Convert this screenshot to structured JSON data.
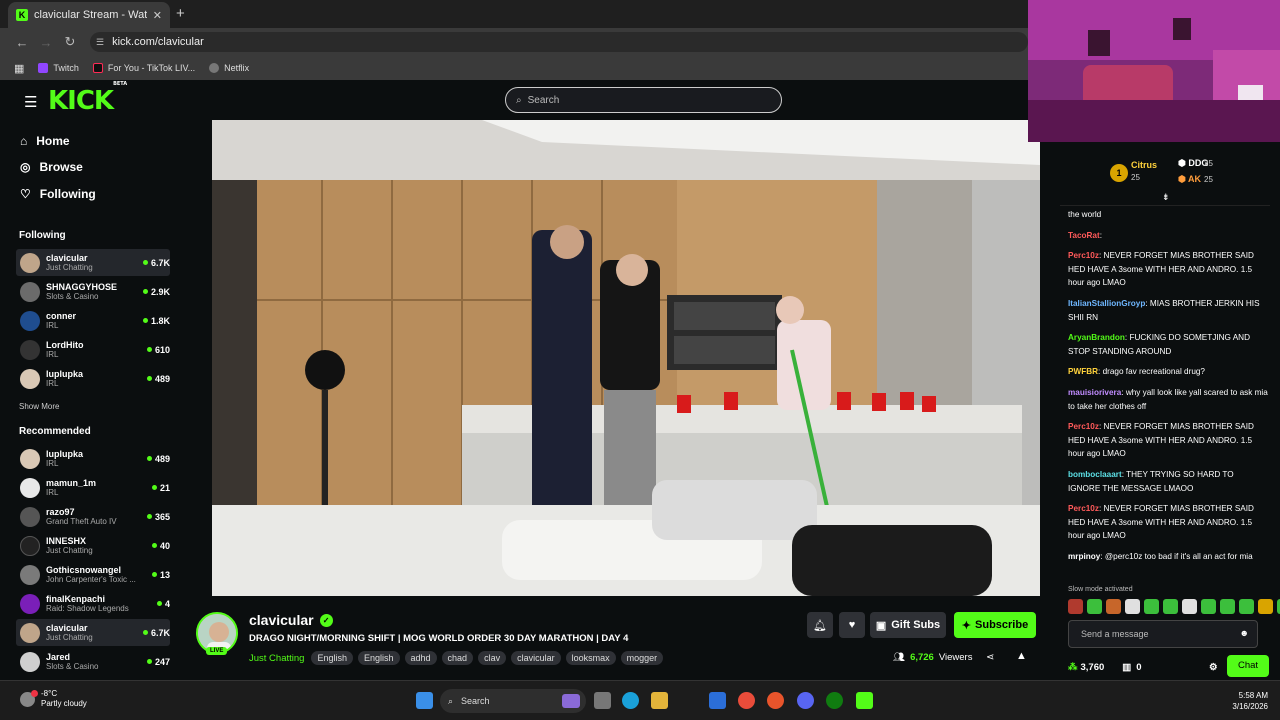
{
  "browser": {
    "tab_title": "clavicular Stream - Watch Live ...",
    "url": "kick.com/clavicular",
    "bookmarks": [
      "Twitch",
      "For You - TikTok LIV...",
      "Netflix"
    ]
  },
  "header": {
    "logo": "KICK",
    "logo_badge": "BETA",
    "search_placeholder": "Search"
  },
  "sidebar": {
    "nav": [
      {
        "label": "Home",
        "icon": "home-icon"
      },
      {
        "label": "Browse",
        "icon": "compass-icon"
      },
      {
        "label": "Following",
        "icon": "heart-icon"
      }
    ],
    "following_heading": "Following",
    "following": [
      {
        "name": "clavicular",
        "category": "Just Chatting",
        "viewers": "6.7K"
      },
      {
        "name": "SHNAGGYHOSE",
        "category": "Slots & Casino",
        "viewers": "2.9K"
      },
      {
        "name": "conner",
        "category": "IRL",
        "viewers": "1.8K"
      },
      {
        "name": "LordHito",
        "category": "IRL",
        "viewers": "610"
      },
      {
        "name": "luplupka",
        "category": "IRL",
        "viewers": "489"
      }
    ],
    "show_more": "Show More",
    "recommended_heading": "Recommended",
    "recommended": [
      {
        "name": "luplupka",
        "category": "IRL",
        "viewers": "489"
      },
      {
        "name": "mamun_1m",
        "category": "IRL",
        "viewers": "21"
      },
      {
        "name": "razo97",
        "category": "Grand Theft Auto IV",
        "viewers": "365"
      },
      {
        "name": "INNESHX",
        "category": "Just Chatting",
        "viewers": "40"
      },
      {
        "name": "Gothicsnowangel",
        "category": "John Carpenter's Toxic ...",
        "viewers": "13"
      },
      {
        "name": "finalKenpachi",
        "category": "Raid: Shadow Legends",
        "viewers": "4"
      },
      {
        "name": "clavicular",
        "category": "Just Chatting",
        "viewers": "6.7K"
      },
      {
        "name": "Jared",
        "category": "Slots & Casino",
        "viewers": "247"
      }
    ]
  },
  "stream": {
    "streamer": "clavicular",
    "live_badge": "LIVE",
    "title": "DRAGO NIGHT/MORNING SHIFT | MOG WORLD ORDER 30 DAY MARATHON | DAY 4",
    "category": "Just Chatting",
    "tags": [
      "English",
      "English",
      "adhd",
      "chad",
      "clav",
      "clavicular",
      "looksmax",
      "mogger"
    ],
    "gift_label": "Gift Subs",
    "subscribe_label": "Subscribe",
    "viewers": "6,726",
    "viewers_label": "Viewers"
  },
  "chat": {
    "leaderboard": [
      {
        "name": "Citrus",
        "value": "25"
      },
      {
        "name": "DDG",
        "value": "25"
      },
      {
        "name": "AK",
        "value": "25"
      }
    ],
    "messages": [
      {
        "user": "",
        "text": "the world",
        "color": "#ffffff"
      },
      {
        "user": "TacoRat",
        "text": "",
        "color": "#ff5a5a"
      },
      {
        "user": "Perc10z",
        "text": "NEVER FORGET MIAS BROTHER SAID HED HAVE A 3some WITH HER AND ANDRO. 1.5 hour ago LMAO",
        "color": "#ff5a5a"
      },
      {
        "user": "ItalianStallionGroyp",
        "text": "MIAS BROTHER JERKIN HIS SHII RN",
        "color": "#6fb7ff"
      },
      {
        "user": "AryanBrandon",
        "text": "FUCKING DO SOMETJING AND STOP STANDING AROUND",
        "color": "#53fc18"
      },
      {
        "user": "PWFBR",
        "text": "drago fav recreational drug?",
        "color": "#ffd23c"
      },
      {
        "user": "mauisiorivera",
        "text": "why yall look like yall scared to ask mia to take her clothes off",
        "color": "#c18cff"
      },
      {
        "user": "Perc10z",
        "text": "NEVER FORGET MIAS BROTHER SAID HED HAVE A 3some WITH HER AND ANDRO. 1.5 hour ago LMAO",
        "color": "#ff5a5a"
      },
      {
        "user": "bomboclaaart",
        "text": "THEY TRYING SO HARD TO IGNORE THE MESSAGE LMAOO",
        "color": "#5ce0e6"
      },
      {
        "user": "Perc10z",
        "text": "NEVER FORGET MIAS BROTHER SAID HED HAVE A 3some WITH HER AND ANDRO. 1.5 hour ago LMAO",
        "color": "#ff5a5a"
      },
      {
        "user": "mrpinoy",
        "text": "@perc10z too bad if it's all an act for mia",
        "color": "#ffffff"
      }
    ],
    "slow_mode": "Slow mode activated",
    "input_placeholder": "Send a message",
    "points": "3,760",
    "inventory": "0",
    "chat_button": "Chat"
  },
  "taskbar": {
    "temp": "-8°C",
    "weather": "Partly cloudy",
    "search": "Search",
    "time": "5:58 AM",
    "date": "3/16/2026"
  },
  "colors": {
    "accent": "#53fc18",
    "background": "#0b0e0f",
    "surface": "#2f3136"
  }
}
